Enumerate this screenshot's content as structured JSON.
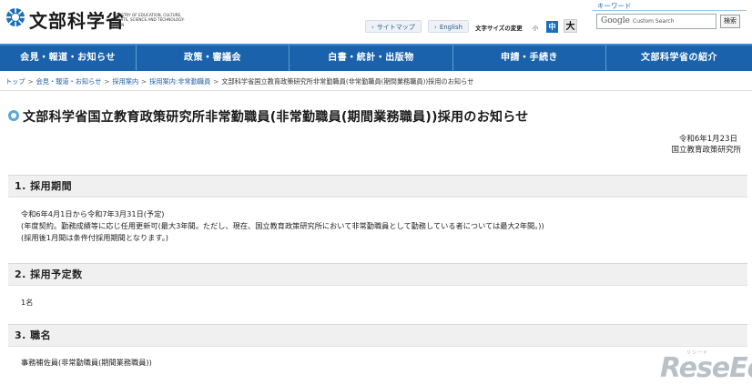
{
  "header": {
    "logo_text": "文部科学省",
    "logo_sub": "MINISTRY OF EDUCATION, CULTURE, SPORTS, SCIENCE AND TECHNOLOGY-JAPAN",
    "sitemap_label": "サイトマップ",
    "english_label": "English",
    "font_size_label": "文字サイズの変更",
    "font_small": "小",
    "font_mid": "中",
    "font_big": "大",
    "keyword_label": "キーワード",
    "search_brand": "Google",
    "search_placeholder": "Custom Search",
    "search_button": "検索"
  },
  "nav": {
    "items": [
      {
        "label": "会見・報道・お知らせ"
      },
      {
        "label": "政策・審議会"
      },
      {
        "label": "白書・統計・出版物"
      },
      {
        "label": "申請・手続き"
      },
      {
        "label": "文部科学省の紹介"
      }
    ]
  },
  "breadcrumb": {
    "items": [
      "トップ",
      "会見・報道・お知らせ",
      "採用案内",
      "採用案内:非常勤職員"
    ],
    "current": "文部科学省国立教育政策研究所非常勤職員(非常勤職員(期間業務職員))採用のお知らせ"
  },
  "page": {
    "title": "文部科学省国立教育政策研究所非常勤職員(非常勤職員(期間業務職員))採用のお知らせ",
    "date": "令和6年1月23日",
    "org": "国立教育政策研究所"
  },
  "sections": [
    {
      "heading": "1. 採用期間",
      "lines": [
        "令和6年4月1日から令和7年3月31日(予定)",
        "(年度契約。勤務成績等に応じ任用更新可(最大3年間。ただし、現在、国立教育政策研究所において非常勤職員として勤務している者については最大2年間。))",
        "(採用後1月間は条件付採用期間となります。)"
      ]
    },
    {
      "heading": "2. 採用予定数",
      "lines": [
        "1名"
      ]
    },
    {
      "heading": "3. 職名",
      "lines": [
        "事務補佐員(非常勤職員(期間業務職員))"
      ]
    }
  ],
  "watermark": {
    "small": "リシード",
    "text": "ReseEd"
  }
}
